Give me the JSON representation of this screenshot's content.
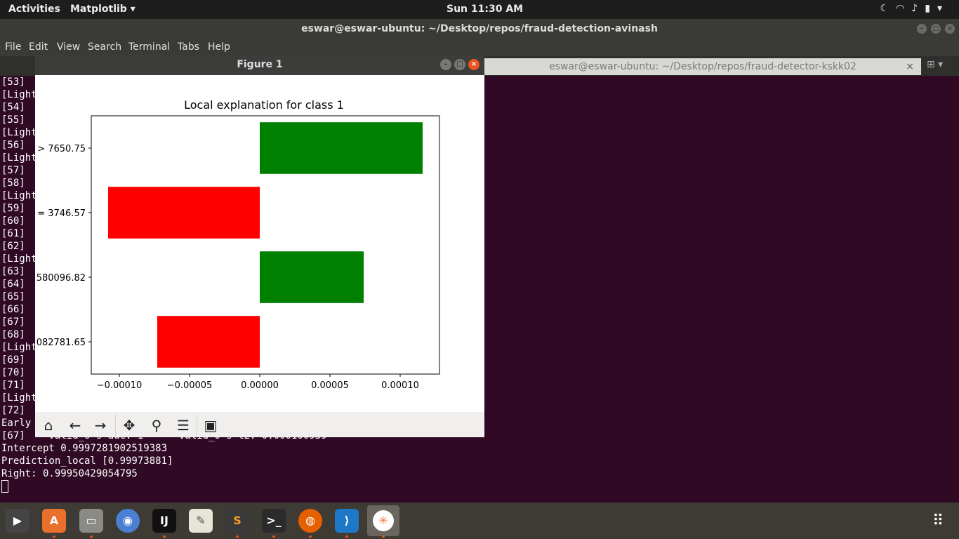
{
  "topbar": {
    "activities": "Activities",
    "app_menu": "Matplotlib ▾",
    "clock": "Sun 11:30 AM"
  },
  "terminal": {
    "window_title": "eswar@eswar-ubuntu: ~/Desktop/repos/fraud-detection-avinash",
    "menu": [
      "File",
      "Edit",
      "View",
      "Search",
      "Terminal",
      "Tabs",
      "Help"
    ],
    "second_tab": "eswar@eswar-ubuntu: ~/Desktop/repos/fraud-detector-kskk02",
    "lines": [
      "[53]",
      "[Light",
      "[54]",
      "[55]",
      "[Light",
      "[56]",
      "[Light",
      "[57]",
      "[58]",
      "[Light",
      "[59]",
      "[60]",
      "[61]",
      "[62]",
      "[Light",
      "[63]",
      "[64]",
      "[65]",
      "[66]",
      "[67]",
      "[68]",
      "[Light",
      "[69]",
      "[70]",
      "[71]",
      "[Light",
      "[72]",
      "Early",
      "[67]    valid_0's auc: 1      valid_0's l2: 0.000100939",
      "Intercept 0.9997281902519383",
      "Prediction_local [0.99973881]",
      "Right: 0.99950429054795"
    ]
  },
  "figure": {
    "window_title": "Figure 1",
    "toolbar": [
      "home-icon",
      "back-arrow-icon",
      "forward-arrow-icon",
      "pan-icon",
      "zoom-icon",
      "configure-subplots-icon",
      "save-icon"
    ]
  },
  "chart_data": {
    "type": "bar",
    "orientation": "horizontal",
    "title": "Local explanation for class 1",
    "categories": [
      "> 7650.75",
      "= 3746.57",
      "580096.82",
      "082781.65"
    ],
    "values": [
      0.000116,
      -0.000108,
      7.4e-05,
      -7.3e-05
    ],
    "colors": [
      "#008000",
      "#ff0000",
      "#008000",
      "#ff0000"
    ],
    "xlim": [
      -0.00012,
      0.000128
    ],
    "xticks": [
      -0.0001,
      -5e-05,
      0,
      5e-05,
      0.0001
    ],
    "xtick_labels": [
      "−0.00010",
      "−0.00005",
      "0.00000",
      "0.00005",
      "0.00010"
    ],
    "grid": false
  }
}
